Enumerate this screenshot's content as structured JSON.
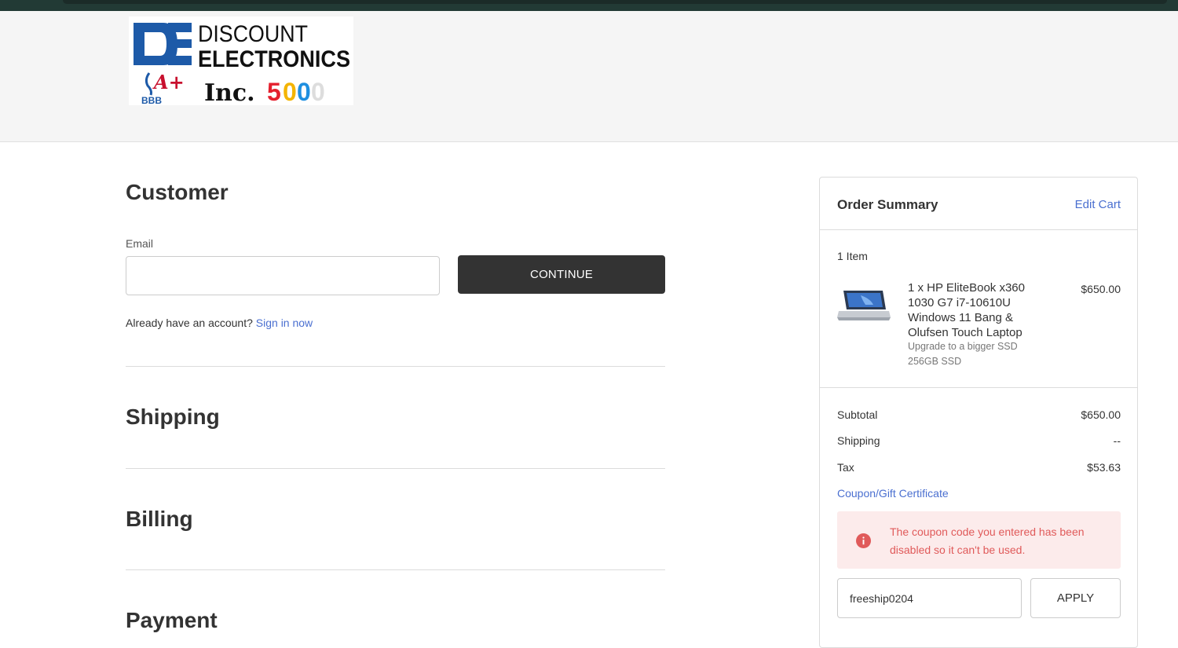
{
  "header": {
    "logo": {
      "brand_line1": "DISCOUNT",
      "brand_line2": "ELECTRONICS",
      "monogram": "DE",
      "bbb_rating": "A+",
      "bbb_text": "BBB",
      "inc_text": "Inc.",
      "inc_number": "5000"
    }
  },
  "checkout": {
    "customer": {
      "title": "Customer",
      "email_label": "Email",
      "email_value": "",
      "continue_label": "CONTINUE",
      "account_prompt": "Already have an account?",
      "sign_in_label": "Sign in now"
    },
    "shipping_title": "Shipping",
    "billing_title": "Billing",
    "payment_title": "Payment"
  },
  "order_summary": {
    "title": "Order Summary",
    "edit_cart_label": "Edit Cart",
    "item_count": "1 Item",
    "item": {
      "name": "1 x HP EliteBook x360 1030 G7 i7-10610U Windows 11 Bang & Olufsen Touch Laptop",
      "option_label": "Upgrade to a bigger SSD",
      "option_value": "256GB SSD",
      "price": "$650.00",
      "thumbnail_icon": "laptop-thumbnail"
    },
    "totals": {
      "subtotal_label": "Subtotal",
      "subtotal_value": "$650.00",
      "shipping_label": "Shipping",
      "shipping_value": "--",
      "tax_label": "Tax",
      "tax_value": "$53.63"
    },
    "coupon": {
      "link_label": "Coupon/Gift Certificate",
      "error_message": "The coupon code you entered has been disabled so it can't be used.",
      "code_value": "freeship0204",
      "apply_label": "APPLY"
    }
  },
  "colors": {
    "accent_link": "#4a6fd0",
    "button_dark": "#333333",
    "error_text": "#e05a5a",
    "error_bg": "#fcebeb",
    "header_bg": "#f5f5f5",
    "topbar": "#223a35"
  }
}
